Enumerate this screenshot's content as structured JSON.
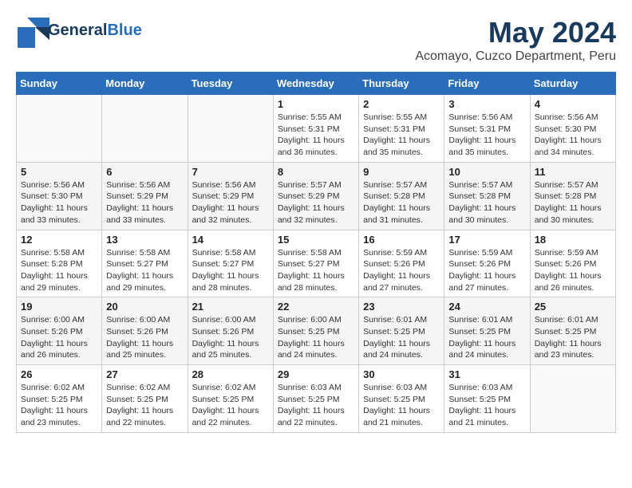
{
  "header": {
    "logo_line1": "General",
    "logo_line2": "Blue",
    "title": "May 2024",
    "subtitle": "Acomayo, Cuzco Department, Peru"
  },
  "days_of_week": [
    "Sunday",
    "Monday",
    "Tuesday",
    "Wednesday",
    "Thursday",
    "Friday",
    "Saturday"
  ],
  "weeks": [
    [
      {
        "num": "",
        "info": ""
      },
      {
        "num": "",
        "info": ""
      },
      {
        "num": "",
        "info": ""
      },
      {
        "num": "1",
        "info": "Sunrise: 5:55 AM\nSunset: 5:31 PM\nDaylight: 11 hours\nand 36 minutes."
      },
      {
        "num": "2",
        "info": "Sunrise: 5:55 AM\nSunset: 5:31 PM\nDaylight: 11 hours\nand 35 minutes."
      },
      {
        "num": "3",
        "info": "Sunrise: 5:56 AM\nSunset: 5:31 PM\nDaylight: 11 hours\nand 35 minutes."
      },
      {
        "num": "4",
        "info": "Sunrise: 5:56 AM\nSunset: 5:30 PM\nDaylight: 11 hours\nand 34 minutes."
      }
    ],
    [
      {
        "num": "5",
        "info": "Sunrise: 5:56 AM\nSunset: 5:30 PM\nDaylight: 11 hours\nand 33 minutes."
      },
      {
        "num": "6",
        "info": "Sunrise: 5:56 AM\nSunset: 5:29 PM\nDaylight: 11 hours\nand 33 minutes."
      },
      {
        "num": "7",
        "info": "Sunrise: 5:56 AM\nSunset: 5:29 PM\nDaylight: 11 hours\nand 32 minutes."
      },
      {
        "num": "8",
        "info": "Sunrise: 5:57 AM\nSunset: 5:29 PM\nDaylight: 11 hours\nand 32 minutes."
      },
      {
        "num": "9",
        "info": "Sunrise: 5:57 AM\nSunset: 5:28 PM\nDaylight: 11 hours\nand 31 minutes."
      },
      {
        "num": "10",
        "info": "Sunrise: 5:57 AM\nSunset: 5:28 PM\nDaylight: 11 hours\nand 30 minutes."
      },
      {
        "num": "11",
        "info": "Sunrise: 5:57 AM\nSunset: 5:28 PM\nDaylight: 11 hours\nand 30 minutes."
      }
    ],
    [
      {
        "num": "12",
        "info": "Sunrise: 5:58 AM\nSunset: 5:28 PM\nDaylight: 11 hours\nand 29 minutes."
      },
      {
        "num": "13",
        "info": "Sunrise: 5:58 AM\nSunset: 5:27 PM\nDaylight: 11 hours\nand 29 minutes."
      },
      {
        "num": "14",
        "info": "Sunrise: 5:58 AM\nSunset: 5:27 PM\nDaylight: 11 hours\nand 28 minutes."
      },
      {
        "num": "15",
        "info": "Sunrise: 5:58 AM\nSunset: 5:27 PM\nDaylight: 11 hours\nand 28 minutes."
      },
      {
        "num": "16",
        "info": "Sunrise: 5:59 AM\nSunset: 5:26 PM\nDaylight: 11 hours\nand 27 minutes."
      },
      {
        "num": "17",
        "info": "Sunrise: 5:59 AM\nSunset: 5:26 PM\nDaylight: 11 hours\nand 27 minutes."
      },
      {
        "num": "18",
        "info": "Sunrise: 5:59 AM\nSunset: 5:26 PM\nDaylight: 11 hours\nand 26 minutes."
      }
    ],
    [
      {
        "num": "19",
        "info": "Sunrise: 6:00 AM\nSunset: 5:26 PM\nDaylight: 11 hours\nand 26 minutes."
      },
      {
        "num": "20",
        "info": "Sunrise: 6:00 AM\nSunset: 5:26 PM\nDaylight: 11 hours\nand 25 minutes."
      },
      {
        "num": "21",
        "info": "Sunrise: 6:00 AM\nSunset: 5:26 PM\nDaylight: 11 hours\nand 25 minutes."
      },
      {
        "num": "22",
        "info": "Sunrise: 6:00 AM\nSunset: 5:25 PM\nDaylight: 11 hours\nand 24 minutes."
      },
      {
        "num": "23",
        "info": "Sunrise: 6:01 AM\nSunset: 5:25 PM\nDaylight: 11 hours\nand 24 minutes."
      },
      {
        "num": "24",
        "info": "Sunrise: 6:01 AM\nSunset: 5:25 PM\nDaylight: 11 hours\nand 24 minutes."
      },
      {
        "num": "25",
        "info": "Sunrise: 6:01 AM\nSunset: 5:25 PM\nDaylight: 11 hours\nand 23 minutes."
      }
    ],
    [
      {
        "num": "26",
        "info": "Sunrise: 6:02 AM\nSunset: 5:25 PM\nDaylight: 11 hours\nand 23 minutes."
      },
      {
        "num": "27",
        "info": "Sunrise: 6:02 AM\nSunset: 5:25 PM\nDaylight: 11 hours\nand 22 minutes."
      },
      {
        "num": "28",
        "info": "Sunrise: 6:02 AM\nSunset: 5:25 PM\nDaylight: 11 hours\nand 22 minutes."
      },
      {
        "num": "29",
        "info": "Sunrise: 6:03 AM\nSunset: 5:25 PM\nDaylight: 11 hours\nand 22 minutes."
      },
      {
        "num": "30",
        "info": "Sunrise: 6:03 AM\nSunset: 5:25 PM\nDaylight: 11 hours\nand 21 minutes."
      },
      {
        "num": "31",
        "info": "Sunrise: 6:03 AM\nSunset: 5:25 PM\nDaylight: 11 hours\nand 21 minutes."
      },
      {
        "num": "",
        "info": ""
      }
    ]
  ]
}
